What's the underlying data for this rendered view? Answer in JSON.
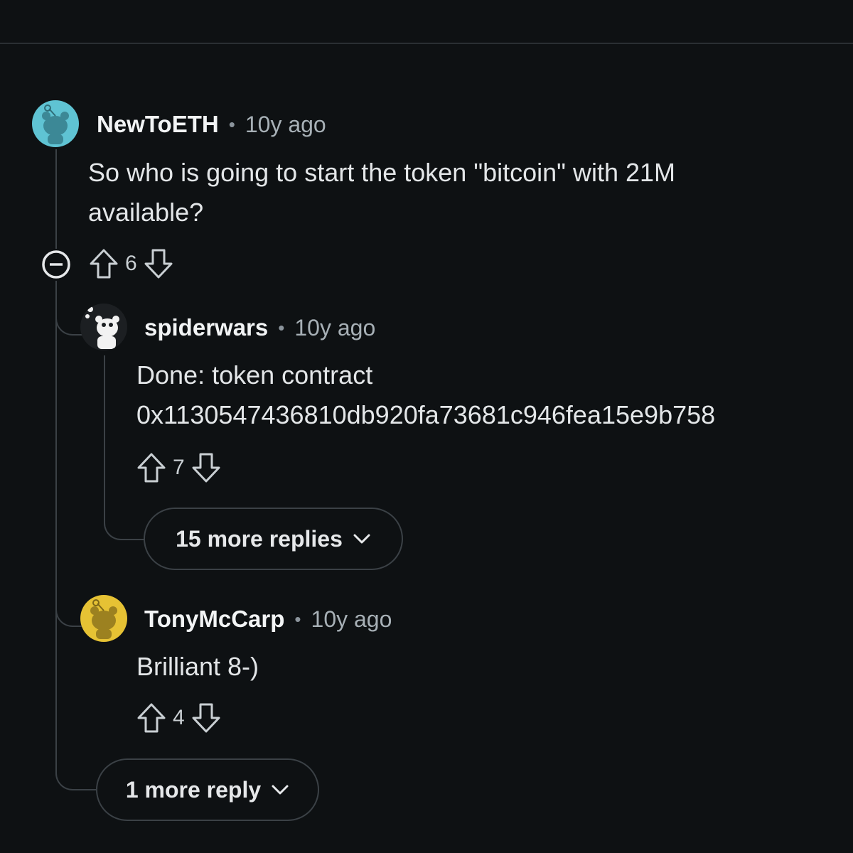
{
  "colors": {
    "background": "#0e1113",
    "thread_line": "#3b4146",
    "avatar_teal": "#5fc3d3",
    "avatar_yellow": "#e6c234",
    "avatar_black": "#111111"
  },
  "comments": [
    {
      "username": "NewToETH",
      "separator": "•",
      "age": "10y ago",
      "lines": [
        "So who is going to start the token \"bitcoin\" with 21M",
        "available?"
      ],
      "score": "6",
      "avatar_icon": "snoo-avatar-teal-icon"
    },
    {
      "username": "spiderwars",
      "separator": "•",
      "age": "10y ago",
      "lines": [
        "Done: token contract",
        "0x1130547436810db920fa73681c946fea15e9b758"
      ],
      "score": "7",
      "avatar_icon": "snoo-avatar-black-icon"
    },
    {
      "username": "TonyMcCarp",
      "separator": "•",
      "age": "10y ago",
      "lines": [
        "Brilliant 8-)"
      ],
      "score": "4",
      "avatar_icon": "snoo-avatar-yellow-icon"
    }
  ],
  "more_replies": [
    {
      "label": "15 more replies",
      "icon": "chevron-down-icon"
    },
    {
      "label": "1 more reply",
      "icon": "chevron-down-icon"
    }
  ],
  "icons": {
    "collapse": "collapse-minus-icon",
    "upvote": "upvote-arrow-icon",
    "downvote": "downvote-arrow-icon"
  }
}
